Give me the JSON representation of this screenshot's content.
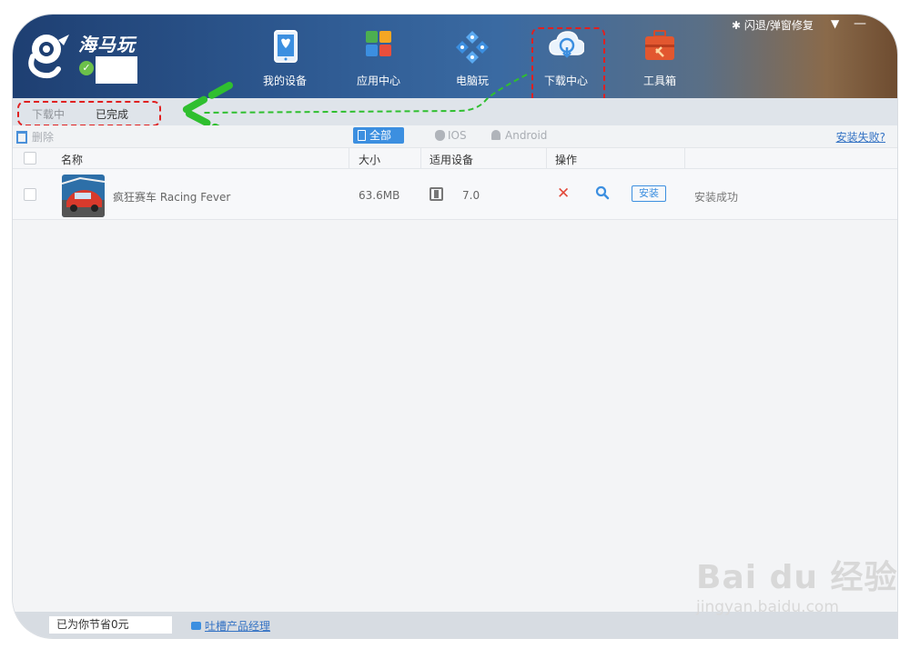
{
  "app": {
    "brand": "海马玩",
    "title_actions": {
      "repair": "闪退/弹窗修复"
    }
  },
  "nav": [
    {
      "label": "我的设备",
      "icon": "tablet-icon"
    },
    {
      "label": "应用中心",
      "icon": "apps-grid-icon"
    },
    {
      "label": "电脑玩",
      "icon": "gamepad-icon"
    },
    {
      "label": "下载中心",
      "icon": "cloud-download-icon"
    },
    {
      "label": "工具箱",
      "icon": "toolbox-icon"
    }
  ],
  "tabs": {
    "downloading": "下载中",
    "completed": "已完成"
  },
  "toolbar": {
    "delete": "删除",
    "filters": {
      "all": "全部",
      "ios": "IOS",
      "android": "Android"
    },
    "install_failed": "安装失败?"
  },
  "table": {
    "headers": {
      "name": "名称",
      "size": "大小",
      "device": "适用设备",
      "actions": "操作"
    },
    "rows": [
      {
        "name": "疯狂赛车 Racing Fever",
        "size": "63.6MB",
        "version": "7.0",
        "install": "安装",
        "status": "安装成功"
      }
    ]
  },
  "footer": {
    "savings": "已为你节省0元",
    "feedback": "吐槽产品经理"
  },
  "watermark": {
    "brand": "Bai du 经验",
    "url": "jingyan.baidu.com"
  },
  "colors": {
    "accent": "#3c8fe0",
    "highlight": "#e02020",
    "arrow": "#2fbf2f"
  }
}
